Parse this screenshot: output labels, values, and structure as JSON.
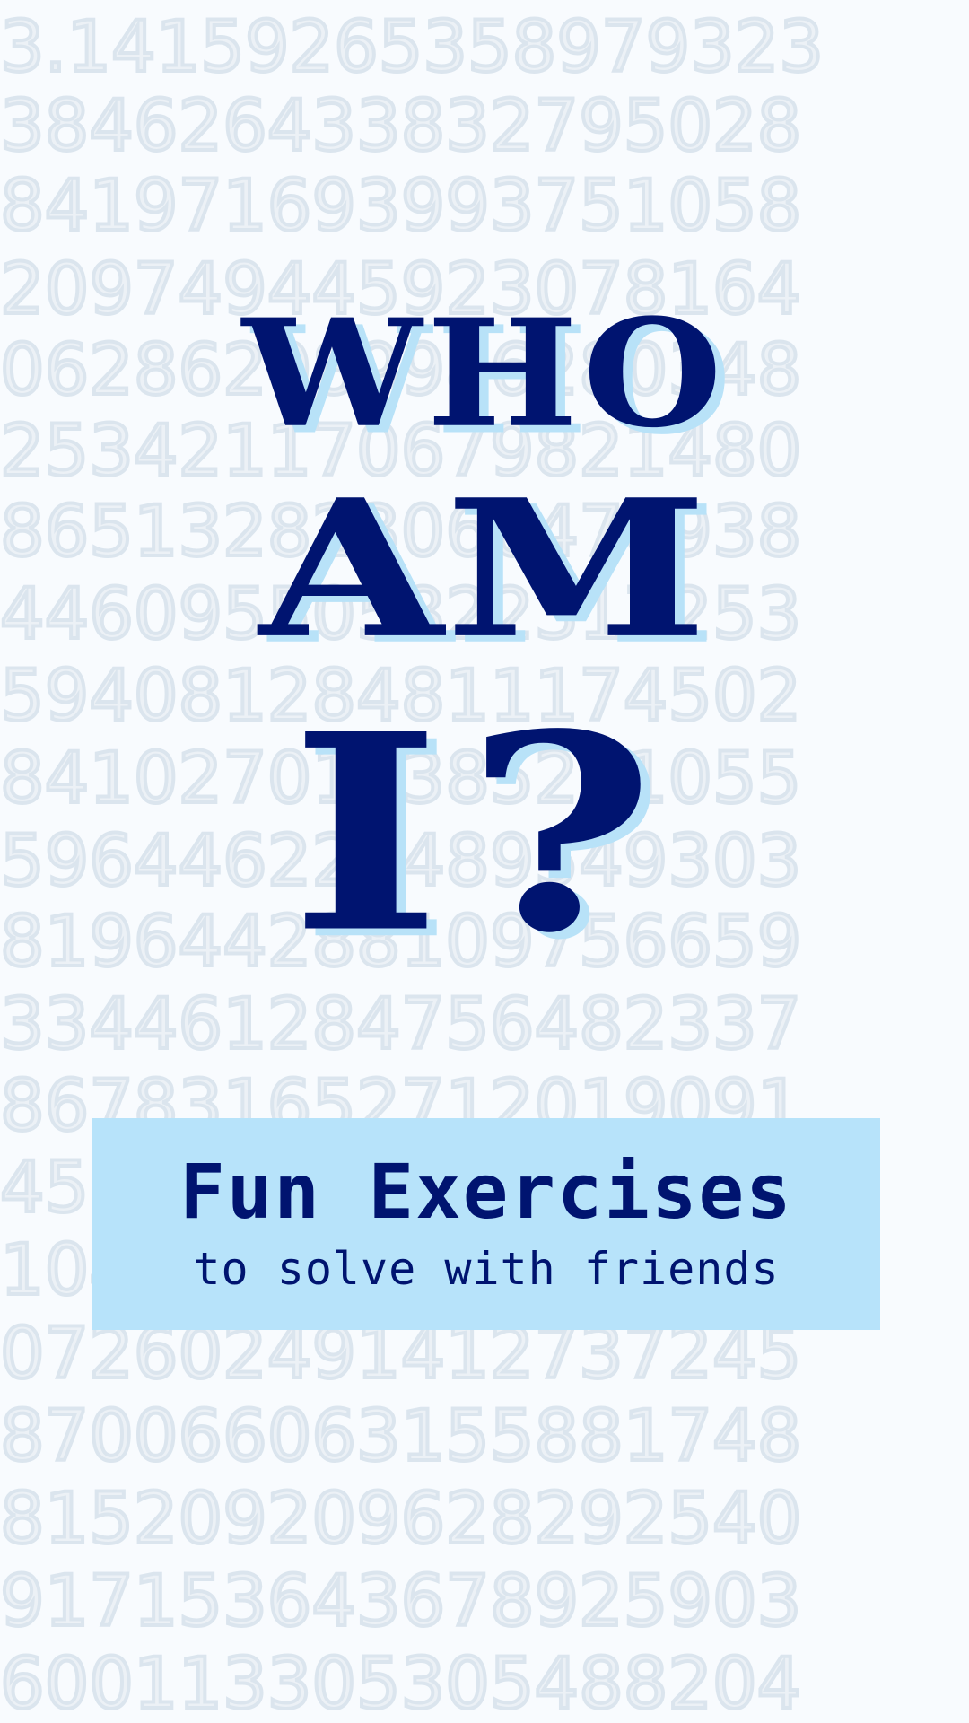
{
  "background": {
    "color": "#f8fbfe",
    "digit_color": "#dbe5ee",
    "rows": [
      "3.14159265358979323",
      "384626433832795028",
      "841971693993751058",
      "209749445923078164",
      "062862089986280348",
      "253421170679821480",
      "865132823066470938",
      "446095505822317253",
      "594081284811174502",
      "841027019385211055",
      "596446229489549303",
      "819644288109756659",
      "334461284756482337",
      "867831652712019091",
      "456485669234603486",
      "104543266482133936",
      "072602491412737245",
      "870066063155881748",
      "815209209628292540",
      "917153643678925903",
      "600113305305488204"
    ]
  },
  "title": {
    "line1": "WHO",
    "line2": "AM",
    "line3": "I?",
    "color": "#001470",
    "shadow_color": "#b8e2f8"
  },
  "banner": {
    "title": "Fun Exercises",
    "subtitle": "to solve with friends",
    "background": "#b7e3fa",
    "text_color": "#001470"
  }
}
